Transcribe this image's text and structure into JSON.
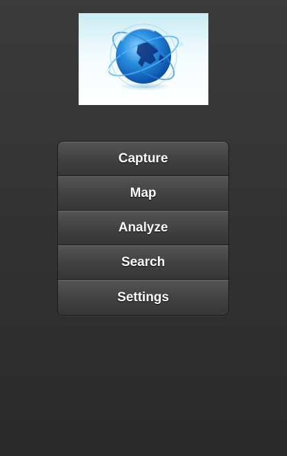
{
  "logo": {
    "icon": "globe-icon"
  },
  "menu": {
    "items": [
      {
        "label": "Capture"
      },
      {
        "label": "Map"
      },
      {
        "label": "Analyze"
      },
      {
        "label": "Search"
      },
      {
        "label": "Settings"
      }
    ]
  },
  "colors": {
    "background": "#333333",
    "button": "#444444",
    "text": "#ffffff",
    "globe_blue": "#1e88d8"
  }
}
